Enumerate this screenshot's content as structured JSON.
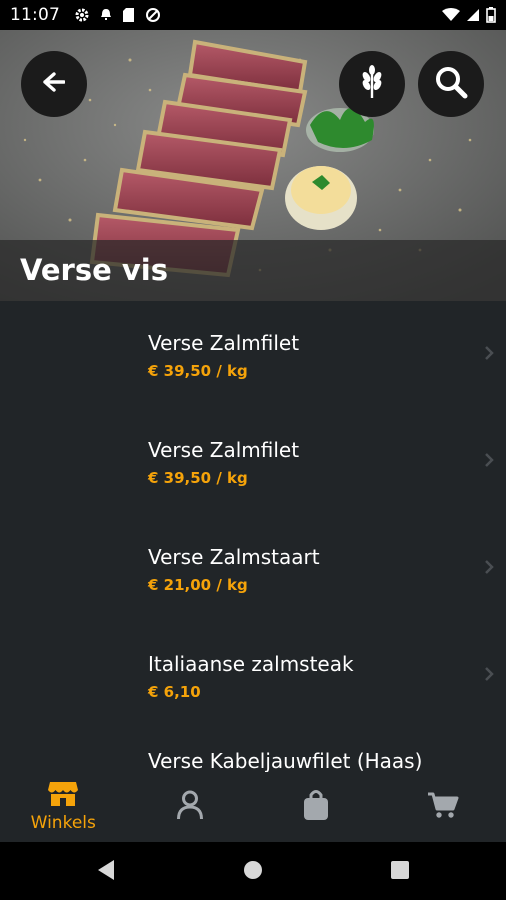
{
  "status_bar": {
    "time": "11:07",
    "left_icons": [
      "gear-icon",
      "notification-dot-icon",
      "sd-card-icon",
      "blocked-icon"
    ],
    "right_icons": [
      "wifi-icon",
      "signal-icon",
      "battery-icon"
    ]
  },
  "header": {
    "title": "Verse vis",
    "buttons": [
      "back-arrow-icon",
      "grain-icon",
      "search-icon"
    ]
  },
  "products": [
    {
      "name": "Verse Zalmfilet",
      "price": "€ 39,50 / kg"
    },
    {
      "name": "Verse Zalmfilet",
      "price": "€ 39,50 / kg"
    },
    {
      "name": "Verse Zalmstaart",
      "price": "€ 21,00 / kg"
    },
    {
      "name": "Italiaanse zalmsteak",
      "price": "€ 6,10"
    },
    {
      "name": "Verse Kabeljauwfilet (Haas)",
      "price": ""
    }
  ],
  "bottom_nav": {
    "active_label": "Winkels",
    "tabs": [
      "store-icon",
      "person-icon",
      "bag-icon",
      "cart-icon"
    ]
  },
  "colors": {
    "accent": "#f5a30a",
    "background": "#212528",
    "button": "#1b1b1b"
  }
}
